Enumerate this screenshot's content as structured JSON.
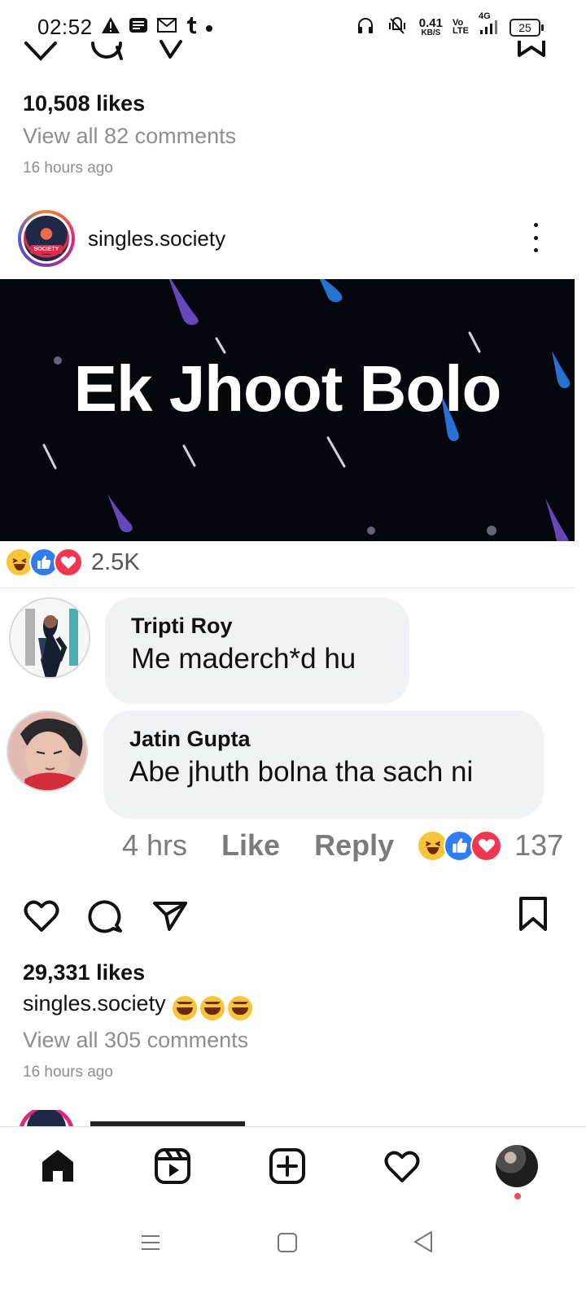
{
  "status_bar": {
    "time": "02:52",
    "left_icons": [
      "warning-icon",
      "news-icon",
      "gmail-icon",
      "tumblr-icon",
      "dot-icon"
    ],
    "right_icons": [
      "headphones-icon",
      "vibrate-off-icon",
      "data-speed-icon",
      "volte-icon",
      "signal-icon"
    ],
    "data_speed": "0.41",
    "data_unit": "KB/S",
    "volte_label": "Vo LTE",
    "network_label": "4G",
    "battery_level": "25"
  },
  "previous_post": {
    "likes": "10,508 likes",
    "comments_link": "View all 82 comments",
    "time_ago": "16 hours ago"
  },
  "post": {
    "username": "singles.society",
    "media_title": "Ek Jhoot Bolo",
    "reaction_count": "2.5K",
    "comments": [
      {
        "name": "Tripti Roy",
        "text": "Me maderch*d hu"
      },
      {
        "name": "Jatin Gupta",
        "text": "Abe jhuth bolna tha sach ni"
      }
    ],
    "comment_footer": {
      "time": "4 hrs",
      "like": "Like",
      "reply": "Reply",
      "reaction_count": "137"
    },
    "likes": "29,331 likes",
    "caption_username": "singles.society",
    "caption_emoji_count": 3,
    "comments_link": "View all 305 comments",
    "time_ago": "16 hours ago"
  },
  "bottom_nav": {
    "items": [
      "home-icon",
      "reels-icon",
      "create-icon",
      "activity-icon",
      "profile-avatar"
    ]
  },
  "colors": {
    "muted": "#8e8e8e",
    "bubble": "#f0f2f5",
    "banner_bg": "#05070c",
    "laugh": "#f7c53a",
    "like": "#2f7cf6",
    "love": "#f13652",
    "notification_dot": "#f34a5a"
  }
}
